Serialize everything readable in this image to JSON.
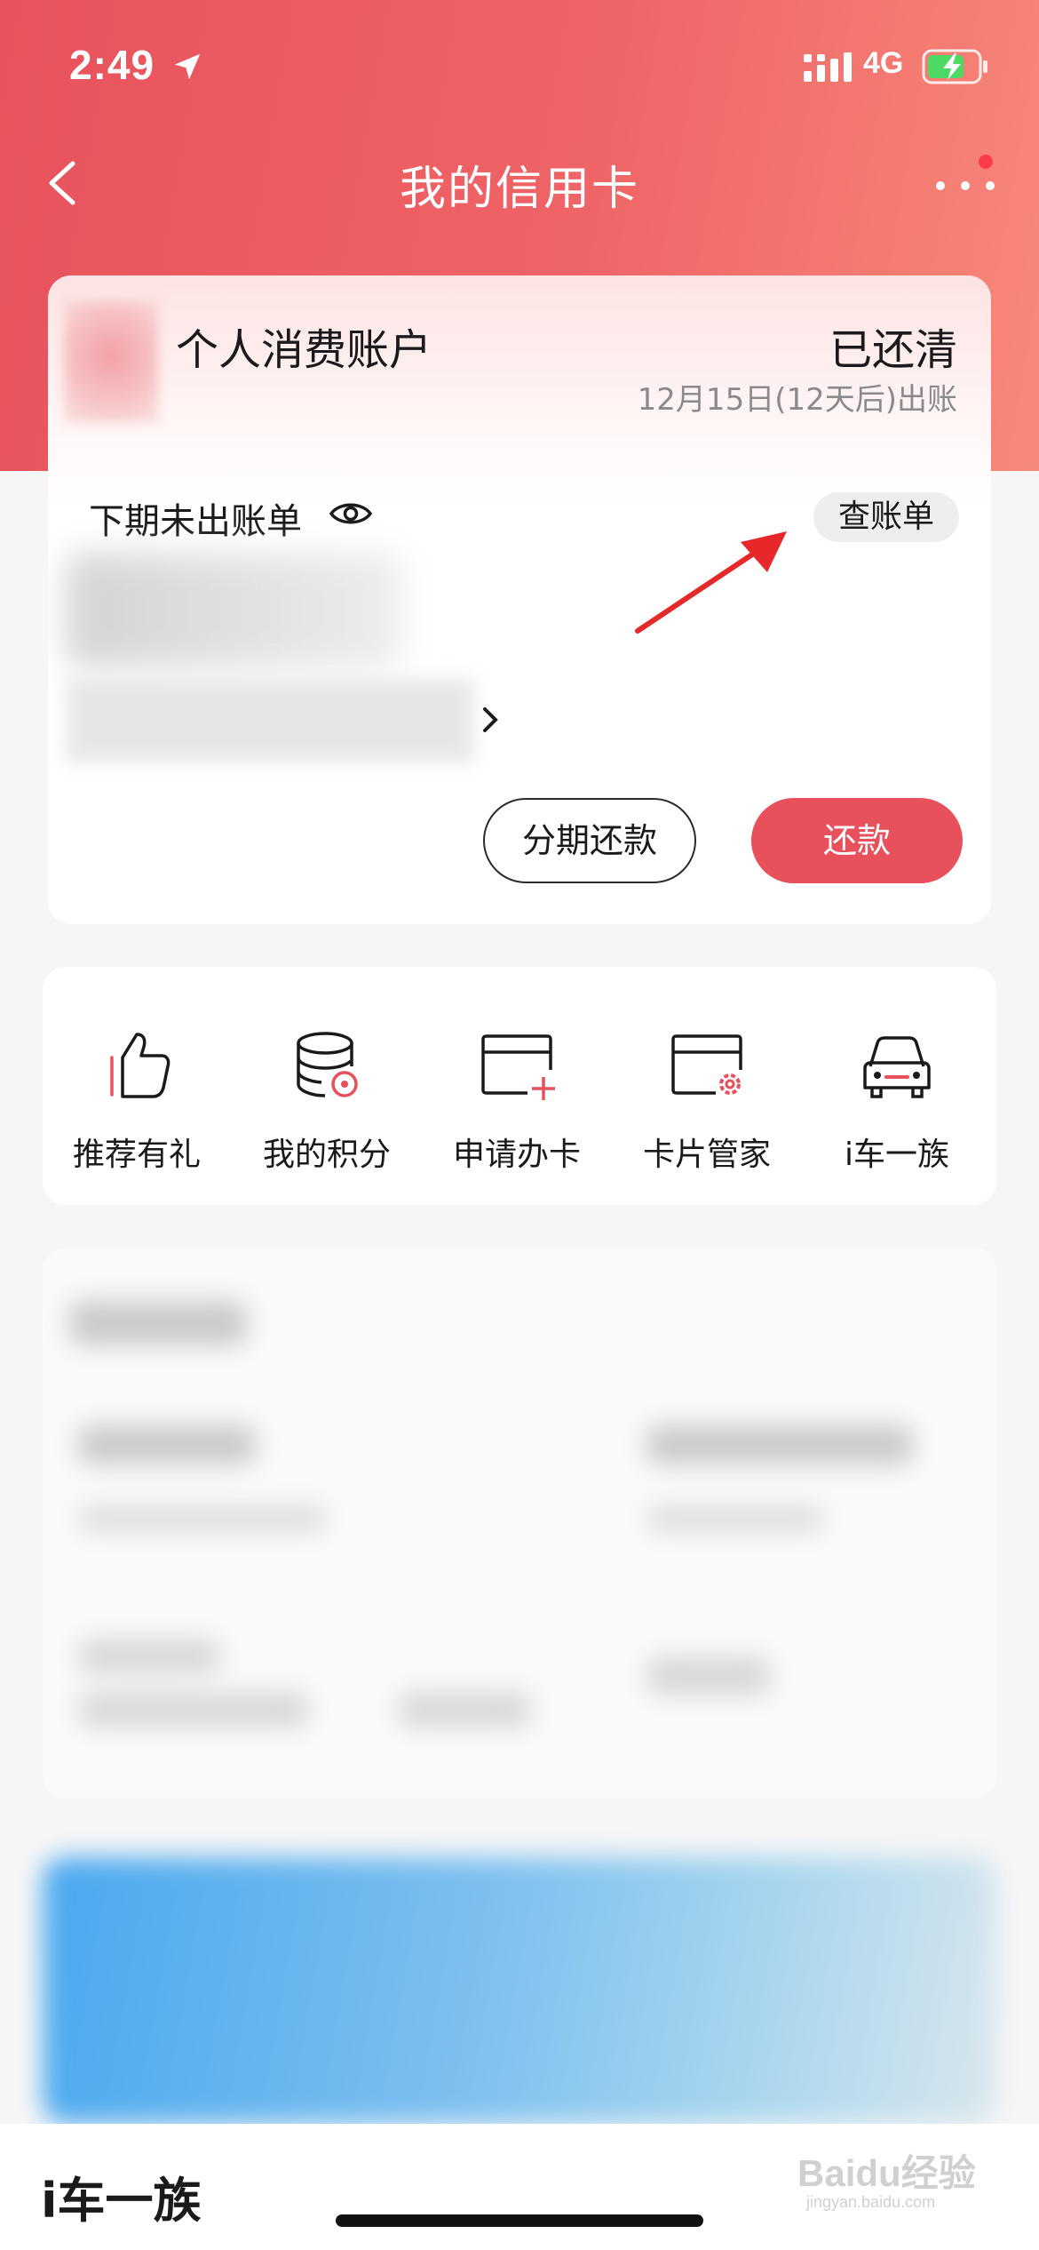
{
  "status_bar": {
    "time": "2:49",
    "network": "4G"
  },
  "nav": {
    "title": "我的信用卡"
  },
  "account_card": {
    "name": "个人消费账户",
    "status": "已还清",
    "bill_date": "12月15日(12天后)出账",
    "next_bill_label": "下期未出账单",
    "view_bill_label": "查账单",
    "installment_label": "分期还款",
    "repay_label": "还款"
  },
  "quick_menu": [
    {
      "label": "推荐有礼",
      "icon": "thumbs-up-icon"
    },
    {
      "label": "我的积分",
      "icon": "points-coins-icon"
    },
    {
      "label": "申请办卡",
      "icon": "apply-card-icon"
    },
    {
      "label": "卡片管家",
      "icon": "card-settings-icon"
    },
    {
      "label": "i车一族",
      "icon": "car-icon"
    }
  ],
  "bottom": {
    "section_title": "i车一族"
  },
  "watermark": {
    "brand": "Baidu经验",
    "url": "jingyan.baidu.com"
  },
  "colors": {
    "accent": "#e8505b",
    "header_start": "#e8525c",
    "header_end": "#f7897a"
  }
}
